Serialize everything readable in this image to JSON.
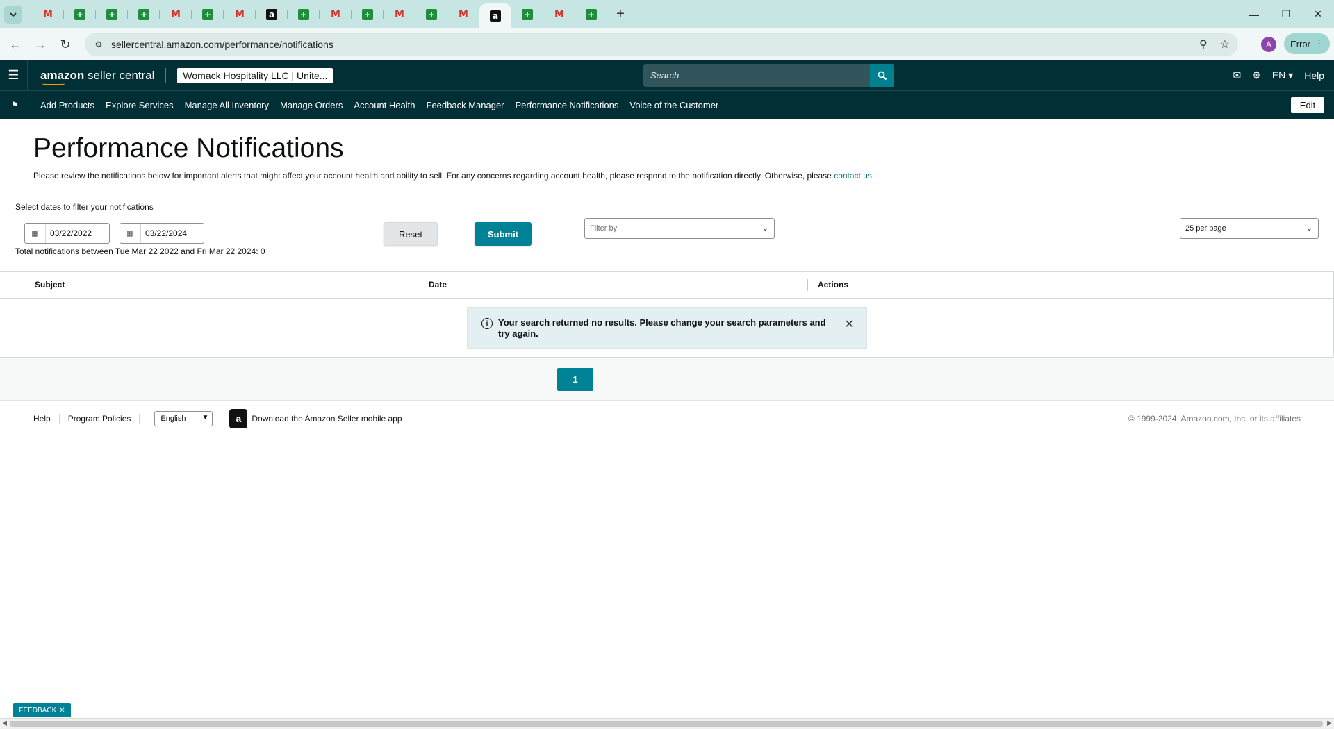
{
  "browser": {
    "tabs": [
      {
        "icon": "gmail-icon",
        "glyph": "M"
      },
      {
        "icon": "sheets-icon",
        "glyph": "+"
      },
      {
        "icon": "sheets-icon",
        "glyph": "+"
      },
      {
        "icon": "sheets-icon",
        "glyph": "+"
      },
      {
        "icon": "gmail-icon",
        "glyph": "M"
      },
      {
        "icon": "sheets-icon",
        "glyph": "+"
      },
      {
        "icon": "gmail-icon",
        "glyph": "M"
      },
      {
        "icon": "amazon-icon",
        "glyph": "a"
      },
      {
        "icon": "sheets-icon",
        "glyph": "+"
      },
      {
        "icon": "gmail-icon",
        "glyph": "M"
      },
      {
        "icon": "sheets-icon",
        "glyph": "+"
      },
      {
        "icon": "gmail-icon",
        "glyph": "M"
      },
      {
        "icon": "sheets-icon",
        "glyph": "+"
      },
      {
        "icon": "gmail-icon",
        "glyph": "M"
      },
      {
        "icon": "amazon-icon",
        "glyph": "a",
        "active": true
      },
      {
        "icon": "sheets-icon",
        "glyph": "+"
      },
      {
        "icon": "gmail-icon",
        "glyph": "M"
      },
      {
        "icon": "sheets-icon",
        "glyph": "+"
      }
    ],
    "url": "sellercentral.amazon.com/performance/notifications",
    "profile_initial": "A",
    "error_label": "Error"
  },
  "header": {
    "logo_bold": "amazon",
    "logo_text": " seller central",
    "account": "Womack Hospitality LLC | Unite...",
    "search_placeholder": "Search",
    "language": "EN",
    "help": "Help"
  },
  "nav": {
    "items": [
      "Add Products",
      "Explore Services",
      "Manage All Inventory",
      "Manage Orders",
      "Account Health",
      "Feedback Manager",
      "Performance Notifications",
      "Voice of the Customer"
    ],
    "edit": "Edit"
  },
  "page": {
    "title": "Performance Notifications",
    "intro": "Please review the notifications below for important alerts that might affect your account health and ability to sell. For any concerns regarding account health, please respond to the notification directly. Otherwise, please ",
    "contact_link": "contact us.",
    "filter_label": "Select dates to filter your notifications",
    "start_date": "03/22/2022",
    "end_date": "03/22/2024",
    "total": "Total notifications between Tue Mar 22 2022 and Fri Mar 22 2024: 0",
    "reset": "Reset",
    "submit": "Submit",
    "filter_placeholder": "Filter by",
    "per_page": "25 per page"
  },
  "table": {
    "columns": [
      "Subject",
      "Date",
      "Actions"
    ],
    "alert": "Your search returned no results. Please change your search parameters and try again."
  },
  "pagination": {
    "current_page": "1"
  },
  "footer": {
    "links": [
      "Help",
      "Program Policies"
    ],
    "language": "English",
    "app_text": "Download the Amazon Seller mobile app",
    "copyright": "© 1999-2024, Amazon.com, Inc. or its affiliates"
  },
  "feedback": {
    "label": "FEEDBACK"
  },
  "colors": {
    "brand_dark": "#002f36",
    "accent": "#008296",
    "link": "#007185"
  }
}
